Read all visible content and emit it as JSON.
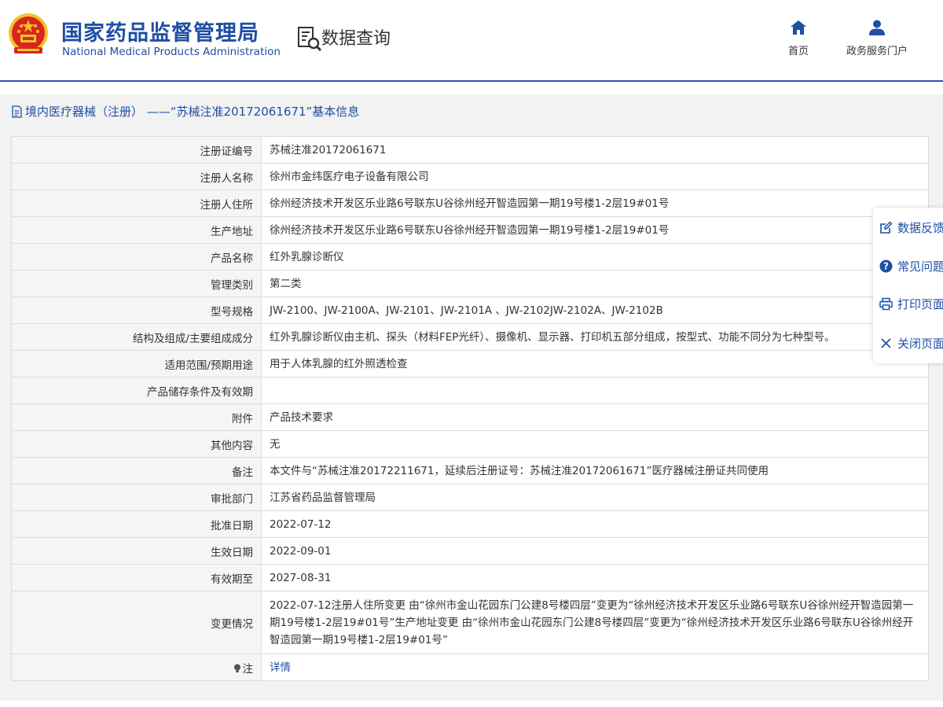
{
  "header": {
    "org_name_cn": "国家药品监督管理局",
    "org_name_en": "National Medical Products Administration",
    "section_title": "数据查询",
    "nav": {
      "home_label": "首页",
      "portal_label": "政务服务门户"
    }
  },
  "page": {
    "heading": "境内医疗器械（注册） ——“苏械注准20172061671”基本信息"
  },
  "rows": [
    {
      "label": "注册证编号",
      "value": "苏械注准20172061671"
    },
    {
      "label": "注册人名称",
      "value": "徐州市金纬医疗电子设备有限公司"
    },
    {
      "label": "注册人住所",
      "value": "徐州经济技术开发区乐业路6号联东U谷徐州经开智造园第一期19号楼1-2层19#01号"
    },
    {
      "label": "生产地址",
      "value": "徐州经济技术开发区乐业路6号联东U谷徐州经开智造园第一期19号楼1-2层19#01号"
    },
    {
      "label": "产品名称",
      "value": "红外乳腺诊断仪"
    },
    {
      "label": "管理类别",
      "value": "第二类"
    },
    {
      "label": "型号规格",
      "value": "JW-2100、JW-2100A、JW-2101、JW-2101A 、JW-2102JW-2102A、JW-2102B"
    },
    {
      "label": "结构及组成/主要组成成分",
      "value": "红外乳腺诊断仪由主机、探头（材料FEP光纤）、摄像机、显示器、打印机五部分组成，按型式、功能不同分为七种型号。"
    },
    {
      "label": "适用范围/预期用途",
      "value": "用于人体乳腺的红外照透检查"
    },
    {
      "label": "产品储存条件及有效期",
      "value": ""
    },
    {
      "label": "附件",
      "value": "产品技术要求"
    },
    {
      "label": "其他内容",
      "value": "无"
    },
    {
      "label": "备注",
      "value": "本文件与“苏械注准20172211671，延续后注册证号：苏械注准20172061671”医疗器械注册证共同使用"
    },
    {
      "label": "审批部门",
      "value": "江苏省药品监督管理局"
    },
    {
      "label": "批准日期",
      "value": "2022-07-12"
    },
    {
      "label": "生效日期",
      "value": "2022-09-01"
    },
    {
      "label": "有效期至",
      "value": "2027-08-31"
    },
    {
      "label": "变更情况",
      "value": "2022-07-12注册人住所变更 由“徐州市金山花园东门公建8号楼四层”变更为“徐州经济技术开发区乐业路6号联东U谷徐州经开智造园第一期19号楼1-2层19#01号”生产地址变更 由“徐州市金山花园东门公建8号楼四层”变更为“徐州经济技术开发区乐业路6号联东U谷徐州经开智造园第一期19号楼1-2层19#01号”"
    },
    {
      "label": "注",
      "value": "详情"
    }
  ],
  "side_panel": {
    "feedback_label": "数据反馈",
    "faq_label": "常见问题",
    "print_label": "打印页面",
    "close_label": "关闭页面"
  },
  "colors": {
    "brand_blue": "#1f4ea5",
    "emblem_red": "#d7261e",
    "emblem_gold": "#f2c12e"
  },
  "icons": [
    "national-emblem-icon",
    "data-query-icon",
    "home-icon",
    "user-icon",
    "document-icon",
    "bulb-icon",
    "edit-icon",
    "question-icon",
    "printer-icon",
    "close-icon"
  ]
}
